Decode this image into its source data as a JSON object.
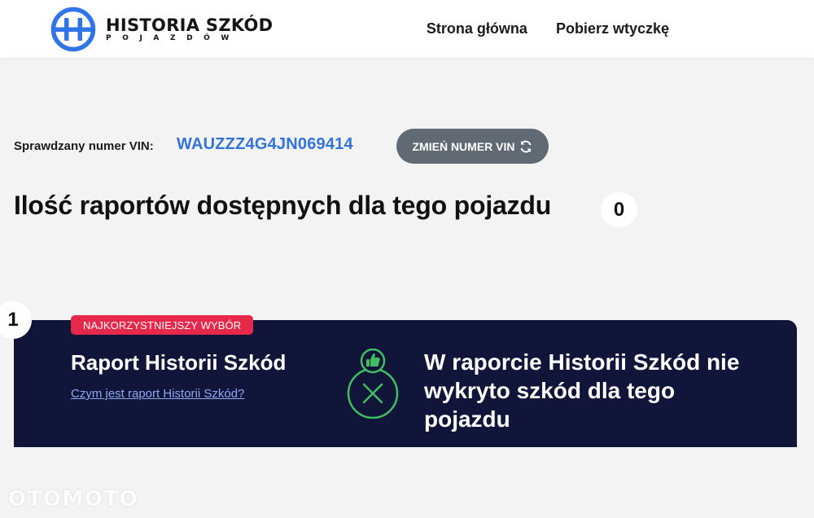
{
  "header": {
    "logo_title": "HISTORIA SZKÓD",
    "logo_subtitle": "POJAZDÓW",
    "nav": {
      "home": "Strona główna",
      "plugin": "Pobierz wtyczkę"
    }
  },
  "vin": {
    "label": "Sprawdzany numer VIN:",
    "value": "WAUZZZ4G4JN069414",
    "change_button": "ZMIEŃ NUMER VIN"
  },
  "reports": {
    "title": "Ilość raportów dostępnych dla tego pojazdu",
    "count": "0"
  },
  "card": {
    "step_number": "1",
    "badge": "NAJKORZYSTNIEJSZY WYBÓR",
    "title": "Raport Historii Szkód",
    "link": "Czym jest raport Historii Szkód?",
    "result_text": "W raporcie Historii Szkód nie wykryto szkód dla tego pojazdu",
    "result_icon": "thumbs-up-x-icon"
  },
  "watermark": "OTOMOTO",
  "colors": {
    "accent_blue": "#3273dc",
    "button_gray": "#616a72",
    "card_navy": "#12153a",
    "badge_red": "#e6284a",
    "icon_green": "#3fbf5f"
  }
}
